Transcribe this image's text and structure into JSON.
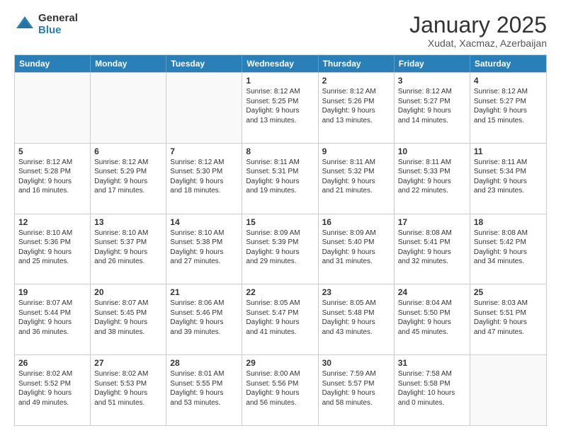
{
  "logo": {
    "general": "General",
    "blue": "Blue"
  },
  "header": {
    "month": "January 2025",
    "location": "Xudat, Xacmaz, Azerbaijan"
  },
  "weekdays": [
    "Sunday",
    "Monday",
    "Tuesday",
    "Wednesday",
    "Thursday",
    "Friday",
    "Saturday"
  ],
  "rows": [
    [
      {
        "day": "",
        "info": ""
      },
      {
        "day": "",
        "info": ""
      },
      {
        "day": "",
        "info": ""
      },
      {
        "day": "1",
        "info": "Sunrise: 8:12 AM\nSunset: 5:25 PM\nDaylight: 9 hours\nand 13 minutes."
      },
      {
        "day": "2",
        "info": "Sunrise: 8:12 AM\nSunset: 5:26 PM\nDaylight: 9 hours\nand 13 minutes."
      },
      {
        "day": "3",
        "info": "Sunrise: 8:12 AM\nSunset: 5:27 PM\nDaylight: 9 hours\nand 14 minutes."
      },
      {
        "day": "4",
        "info": "Sunrise: 8:12 AM\nSunset: 5:27 PM\nDaylight: 9 hours\nand 15 minutes."
      }
    ],
    [
      {
        "day": "5",
        "info": "Sunrise: 8:12 AM\nSunset: 5:28 PM\nDaylight: 9 hours\nand 16 minutes."
      },
      {
        "day": "6",
        "info": "Sunrise: 8:12 AM\nSunset: 5:29 PM\nDaylight: 9 hours\nand 17 minutes."
      },
      {
        "day": "7",
        "info": "Sunrise: 8:12 AM\nSunset: 5:30 PM\nDaylight: 9 hours\nand 18 minutes."
      },
      {
        "day": "8",
        "info": "Sunrise: 8:11 AM\nSunset: 5:31 PM\nDaylight: 9 hours\nand 19 minutes."
      },
      {
        "day": "9",
        "info": "Sunrise: 8:11 AM\nSunset: 5:32 PM\nDaylight: 9 hours\nand 21 minutes."
      },
      {
        "day": "10",
        "info": "Sunrise: 8:11 AM\nSunset: 5:33 PM\nDaylight: 9 hours\nand 22 minutes."
      },
      {
        "day": "11",
        "info": "Sunrise: 8:11 AM\nSunset: 5:34 PM\nDaylight: 9 hours\nand 23 minutes."
      }
    ],
    [
      {
        "day": "12",
        "info": "Sunrise: 8:10 AM\nSunset: 5:36 PM\nDaylight: 9 hours\nand 25 minutes."
      },
      {
        "day": "13",
        "info": "Sunrise: 8:10 AM\nSunset: 5:37 PM\nDaylight: 9 hours\nand 26 minutes."
      },
      {
        "day": "14",
        "info": "Sunrise: 8:10 AM\nSunset: 5:38 PM\nDaylight: 9 hours\nand 27 minutes."
      },
      {
        "day": "15",
        "info": "Sunrise: 8:09 AM\nSunset: 5:39 PM\nDaylight: 9 hours\nand 29 minutes."
      },
      {
        "day": "16",
        "info": "Sunrise: 8:09 AM\nSunset: 5:40 PM\nDaylight: 9 hours\nand 31 minutes."
      },
      {
        "day": "17",
        "info": "Sunrise: 8:08 AM\nSunset: 5:41 PM\nDaylight: 9 hours\nand 32 minutes."
      },
      {
        "day": "18",
        "info": "Sunrise: 8:08 AM\nSunset: 5:42 PM\nDaylight: 9 hours\nand 34 minutes."
      }
    ],
    [
      {
        "day": "19",
        "info": "Sunrise: 8:07 AM\nSunset: 5:44 PM\nDaylight: 9 hours\nand 36 minutes."
      },
      {
        "day": "20",
        "info": "Sunrise: 8:07 AM\nSunset: 5:45 PM\nDaylight: 9 hours\nand 38 minutes."
      },
      {
        "day": "21",
        "info": "Sunrise: 8:06 AM\nSunset: 5:46 PM\nDaylight: 9 hours\nand 39 minutes."
      },
      {
        "day": "22",
        "info": "Sunrise: 8:05 AM\nSunset: 5:47 PM\nDaylight: 9 hours\nand 41 minutes."
      },
      {
        "day": "23",
        "info": "Sunrise: 8:05 AM\nSunset: 5:48 PM\nDaylight: 9 hours\nand 43 minutes."
      },
      {
        "day": "24",
        "info": "Sunrise: 8:04 AM\nSunset: 5:50 PM\nDaylight: 9 hours\nand 45 minutes."
      },
      {
        "day": "25",
        "info": "Sunrise: 8:03 AM\nSunset: 5:51 PM\nDaylight: 9 hours\nand 47 minutes."
      }
    ],
    [
      {
        "day": "26",
        "info": "Sunrise: 8:02 AM\nSunset: 5:52 PM\nDaylight: 9 hours\nand 49 minutes."
      },
      {
        "day": "27",
        "info": "Sunrise: 8:02 AM\nSunset: 5:53 PM\nDaylight: 9 hours\nand 51 minutes."
      },
      {
        "day": "28",
        "info": "Sunrise: 8:01 AM\nSunset: 5:55 PM\nDaylight: 9 hours\nand 53 minutes."
      },
      {
        "day": "29",
        "info": "Sunrise: 8:00 AM\nSunset: 5:56 PM\nDaylight: 9 hours\nand 56 minutes."
      },
      {
        "day": "30",
        "info": "Sunrise: 7:59 AM\nSunset: 5:57 PM\nDaylight: 9 hours\nand 58 minutes."
      },
      {
        "day": "31",
        "info": "Sunrise: 7:58 AM\nSunset: 5:58 PM\nDaylight: 10 hours\nand 0 minutes."
      },
      {
        "day": "",
        "info": ""
      }
    ]
  ]
}
